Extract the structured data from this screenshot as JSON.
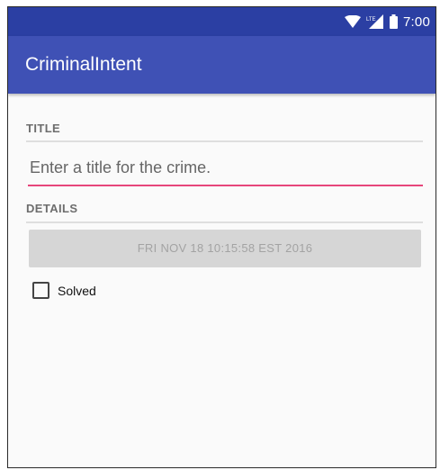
{
  "status_bar": {
    "time": "7:00",
    "lte_label": "LTE",
    "icons": [
      "wifi-icon",
      "cell-signal-icon",
      "battery-icon"
    ]
  },
  "app_bar": {
    "title": "CriminalIntent"
  },
  "title_section": {
    "header": "TITLE",
    "input_placeholder": "Enter a title for the crime.",
    "input_value": ""
  },
  "details_section": {
    "header": "DETAILS",
    "date_button_label": "FRI NOV 18 10:15:58 EST 2016",
    "solved_label": "Solved",
    "solved_checked": false
  },
  "colors": {
    "status_bar": "#2b3fa3",
    "app_bar": "#3f51b5",
    "accent": "#e7467b",
    "date_button_bg": "#d6d6d6"
  }
}
